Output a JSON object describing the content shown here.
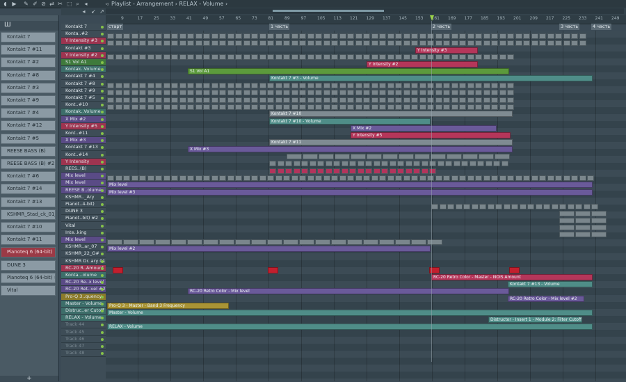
{
  "window": {
    "title": "Playlist - Arrangement",
    "arrangement": "RELAX",
    "target": "Volume",
    "breadcrumb": "Playlist - Arrangement › RELAX - Volume ›"
  },
  "browser": {
    "head_label": "Ш",
    "channels": [
      {
        "label": "Kontakt 7",
        "red": false
      },
      {
        "label": "Kontakt 7 #11",
        "red": false
      },
      {
        "label": "Kontakt 7 #2",
        "red": false
      },
      {
        "label": "Kontakt 7 #8",
        "red": false
      },
      {
        "label": "Kontakt 7 #3",
        "red": false
      },
      {
        "label": "Kontakt 7 #9",
        "red": false
      },
      {
        "label": "Kontakt 7 #4",
        "red": false
      },
      {
        "label": "Kontakt 7 #12",
        "red": false
      },
      {
        "label": "Kontakt 7 #5",
        "red": false
      },
      {
        "label": "REESE BASS (B)",
        "red": false
      },
      {
        "label": "REESE BASS (B) #2",
        "red": false
      },
      {
        "label": "Kontakt 7 #6",
        "red": false
      },
      {
        "label": "Kontakt 7 #14",
        "red": false
      },
      {
        "label": "Kontakt 7 #13",
        "red": false
      },
      {
        "label": "KSHMR_Stad_ck_01_Ary",
        "red": false
      },
      {
        "label": "Kontakt 7 #10",
        "red": false
      },
      {
        "label": "Kontakt 7 #11",
        "red": false
      },
      {
        "label": "Pianoteq 6 (64-bit)",
        "red": true
      },
      {
        "label": "DUNE 3",
        "red": false
      },
      {
        "label": "Pianoteq 6 (64-bit) #2",
        "red": false
      },
      {
        "label": "Vital",
        "red": false
      }
    ],
    "add_label": "+"
  },
  "ruler": {
    "ticks": [
      "9",
      "17",
      "25",
      "33",
      "41",
      "49",
      "57",
      "65",
      "73",
      "81",
      "89",
      "97",
      "105",
      "113",
      "121",
      "129",
      "137",
      "145",
      "153",
      "161",
      "169",
      "177",
      "185",
      "193",
      "201",
      "209",
      "217",
      "225",
      "233",
      "241",
      "249"
    ]
  },
  "markers": [
    {
      "label": "старт"
    },
    {
      "label": "1 часть"
    },
    {
      "label": "2 часть"
    },
    {
      "label": "3 часть"
    },
    {
      "label": "4 часть"
    }
  ],
  "tracks": [
    {
      "label": "Kontakt 7",
      "style": ""
    },
    {
      "label": "Konta..#2",
      "style": ""
    },
    {
      "label": "Y Intensity #3",
      "style": "red"
    },
    {
      "label": "Kontakt #3",
      "style": ""
    },
    {
      "label": "Y Intensity #2",
      "style": "red"
    },
    {
      "label": "S1 Vol A1",
      "style": "green"
    },
    {
      "label": "Kontak..Volume",
      "style": "teal"
    },
    {
      "label": "Kontakt 7 #4",
      "style": ""
    },
    {
      "label": "Kontakt 7 #8",
      "style": ""
    },
    {
      "label": "Kontakt 7 #9",
      "style": ""
    },
    {
      "label": "Kontakt 7 #5",
      "style": ""
    },
    {
      "label": "Kont..#10",
      "style": ""
    },
    {
      "label": "Kontak..Volume",
      "style": "teal"
    },
    {
      "label": "X Mix #2",
      "style": "purple"
    },
    {
      "label": "Y Intensity #5",
      "style": "red"
    },
    {
      "label": "Kont..#11",
      "style": ""
    },
    {
      "label": "X Mix #3",
      "style": "purple"
    },
    {
      "label": "Kontakt 7 #13",
      "style": ""
    },
    {
      "label": "Kont..#14",
      "style": ""
    },
    {
      "label": "Y Intensity",
      "style": "red"
    },
    {
      "label": "REES..(B)",
      "style": ""
    },
    {
      "label": "Mix level",
      "style": "purple"
    },
    {
      "label": "Mix level",
      "style": "purple"
    },
    {
      "label": "REESE B..olume",
      "style": "purple"
    },
    {
      "label": "KSHMR.._Ary",
      "style": ""
    },
    {
      "label": "Pianot..4-bit)",
      "style": ""
    },
    {
      "label": "DUNE 3",
      "style": ""
    },
    {
      "label": "Pianot..bit) #2",
      "style": ""
    },
    {
      "label": "Vital",
      "style": ""
    },
    {
      "label": "Inte..king",
      "style": ""
    },
    {
      "label": "Mix level",
      "style": "purple"
    },
    {
      "label": "KSHMR..ar_07",
      "style": ""
    },
    {
      "label": "KSHMR_22_G#",
      "style": ""
    },
    {
      "label": "KSHMR Dr..ary 01",
      "style": ""
    },
    {
      "label": "RC-20 R..Amount",
      "style": "red"
    },
    {
      "label": "Konta...olume",
      "style": "teal"
    },
    {
      "label": "RC-20 Re..x level",
      "style": "purple"
    },
    {
      "label": "RC-20 Ret..vel #2",
      "style": "purple"
    },
    {
      "label": "Pro-Q 3..quency",
      "style": "yellow"
    },
    {
      "label": "Master - Volume",
      "style": "teal"
    },
    {
      "label": "Distruc..er Cutoff",
      "style": "teal"
    },
    {
      "label": "RELAX - Volume",
      "style": "teal"
    },
    {
      "label": "Track 44",
      "style": "dim"
    },
    {
      "label": "Track 45",
      "style": "dim"
    },
    {
      "label": "Track 46",
      "style": "dim"
    },
    {
      "label": "Track 47",
      "style": "dim"
    },
    {
      "label": "Track 48",
      "style": "dim"
    }
  ],
  "clips": {
    "y_intensity_3": "Y Intensity #3",
    "y_intensity_2": "Y Intensity #2",
    "s1_vol_a1": "S1 Vol A1",
    "kontakt_3_volume": "Kontakt 7 #3 - Volume",
    "kontakt_10_volume": "Kontakt 7 #10 - Volume",
    "x_mix_2": "X Mix #2",
    "y_intensity_5": "Y Intensity #5",
    "x_mix_3": "X Mix #3",
    "mix_level": "Mix level",
    "mix_level_3": "Mix level #3",
    "mix_level_2": "Mix level #2",
    "rc20_noise": "RC-20 Retro Color - Master - NOIS Amount",
    "kontakt_13_volume": "Kontakt 7 #13 - Volume",
    "rc20_mix": "RC-20 Retro Color - Mix level",
    "rc20_mix_2": "RC-20 Retro Color - Mix level #2",
    "proq_band3": "Pro-Q 3 - Master - Band 3 Frequency",
    "master_volume": "Master - Volume",
    "distructor": "Distructor - Insert 1 - Module 2: Filter Cutoff",
    "relax_volume": "RELAX - Volume",
    "kontakt_10": "Kontakt 7 #10",
    "kontakt_11": "Kontakt 7 #11",
    "inte_img": "Inte..img"
  },
  "colors": {
    "accent_green": "#9cd34a",
    "clip_red": "#b5365a",
    "clip_purple": "#6a5a9a",
    "clip_teal": "#4f8d88",
    "clip_green": "#5c9a3c"
  }
}
